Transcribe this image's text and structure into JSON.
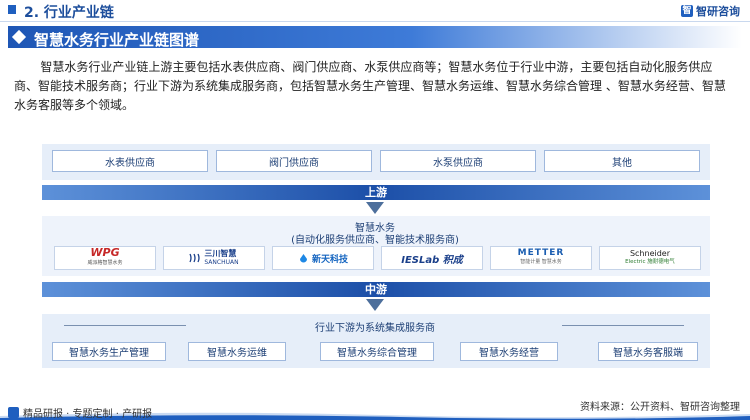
{
  "header": {
    "section_title": "2. 行业产业链",
    "logo_mark": "智",
    "logo_text": "智研咨询"
  },
  "title_bar": {
    "text": "智慧水务行业产业链图谱"
  },
  "intro": "智慧水务行业产业链上游主要包括水表供应商、阀门供应商、水泵供应商等；智慧水务位于行业中游，主要包括自动化服务供应商、智能技术服务商；行业下游为系统集成服务商，包括智慧水务生产管理、智慧水务运维、智慧水务综合管理 、智慧水务经营、智慧水务客服等多个领域。",
  "upstream": {
    "items": [
      "水表供应商",
      "阀门供应商",
      "水泵供应商",
      "其他"
    ],
    "band_label": "上游"
  },
  "midstream": {
    "title": "智慧水务",
    "subtitle": "(自动化服务供应商、智能技术服务商)",
    "companies": [
      {
        "name": "WPG",
        "sub": "威派格智慧水务",
        "color": "#c62828"
      },
      {
        "name": "三川智慧",
        "sub": "SANCHUAN",
        "color": "#1a3f8a"
      },
      {
        "name": "新天科技",
        "sub": "",
        "color": "#1565c0"
      },
      {
        "name": "IESLab 积成",
        "sub": "",
        "color": "#1a3f8a"
      },
      {
        "name": "METTER",
        "sub": "智能计量 智慧水务",
        "color": "#1a5db0"
      },
      {
        "name": "Schneider",
        "sub": "Electric 施耐德电气",
        "color": "#2e7d32"
      }
    ],
    "band_label": "中游"
  },
  "downstream": {
    "title": "行业下游为系统集成服务商",
    "items": [
      "智慧水务生产管理",
      "智慧水务运维",
      "智慧水务综合管理",
      "智慧水务经营",
      "智慧水务客服端"
    ]
  },
  "footer": {
    "left": "精品研报 · 专题定制 · 产研报",
    "right": "资料来源：公开资料、智研咨询整理"
  },
  "colors": {
    "accent": "#1f5fbf",
    "band": "#1c4fa8",
    "panel": "#e6eef9"
  }
}
